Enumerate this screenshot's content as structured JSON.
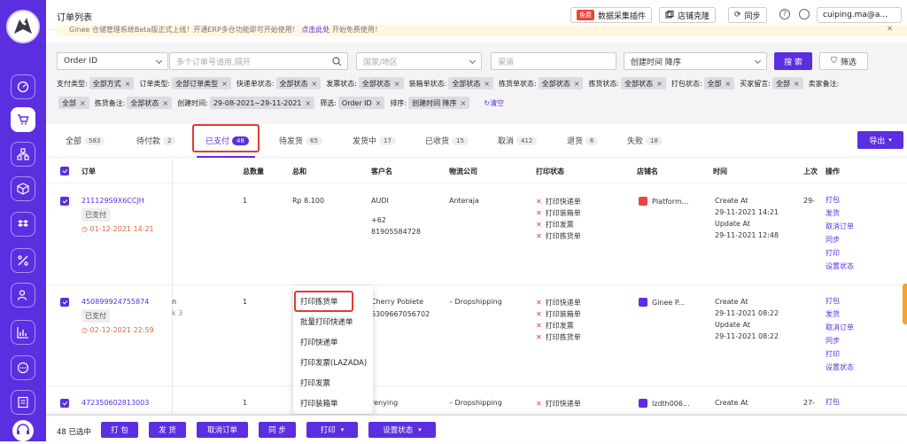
{
  "app": {
    "title": "订单列表"
  },
  "topbar": {
    "free_badge": "免费",
    "plugin_btn": "数据采集插件",
    "clone_btn": "店铺克隆",
    "sync_btn": "同步",
    "user": "cuiping.ma@a..."
  },
  "notice": {
    "text": "Ginee 仓储管理系统Beta版正式上线！开通ERP多仓功能即可开始使用！",
    "link": "点击此处",
    "tail": "开始免费使用！"
  },
  "filters": {
    "order_select": "Order ID",
    "search_placeholder": "多个订单号请用,隔开",
    "country_placeholder": "国家/地区",
    "channel_placeholder": "渠道",
    "sort_select": "创建时间 降序",
    "search_btn": "搜 索",
    "filter_btn": "筛选",
    "line1": [
      {
        "label": "支付类型:",
        "chip": "全部方式"
      },
      {
        "label": "订单类型:",
        "chip": "全部订单类型"
      },
      {
        "label": "快递单状态:",
        "chip": "全部状态"
      },
      {
        "label": "发票状态:",
        "chip": "全部状态"
      },
      {
        "label": "装箱单状态:",
        "chip": "全部状态"
      },
      {
        "label": "拣货单状态:",
        "chip": "全部状态"
      },
      {
        "label": "拣货状态:",
        "chip": "全部状态"
      },
      {
        "label": "打包状态:",
        "chip": "全部"
      },
      {
        "label": "买家留言:",
        "chip": "全部"
      },
      {
        "label": "卖家备注:",
        "chip": ""
      }
    ],
    "line2": [
      {
        "label": "",
        "chip": "全部"
      },
      {
        "label": "拣货备注:",
        "chip": "全部状态"
      },
      {
        "label": "创建时间:",
        "chip": "29-08-2021~29-11-2021"
      },
      {
        "label": "筛选:",
        "chip": "Order ID"
      },
      {
        "label": "排序:",
        "chip": "创建时间 降序"
      }
    ],
    "clear": "清空"
  },
  "tabs": [
    {
      "label": "全部",
      "count": "583"
    },
    {
      "label": "待付款",
      "count": "2"
    },
    {
      "label": "已支付",
      "count": "48"
    },
    {
      "label": "待发货",
      "count": "65"
    },
    {
      "label": "发货中",
      "count": "17"
    },
    {
      "label": "已收货",
      "count": "15"
    },
    {
      "label": "取消",
      "count": "412"
    },
    {
      "label": "退货",
      "count": "6"
    },
    {
      "label": "失败",
      "count": "18"
    }
  ],
  "export_btn": "导出",
  "table": {
    "headers": {
      "order": "订单",
      "qty": "总数量",
      "total": "总和",
      "customer": "客户名",
      "logistics": "物流公司",
      "print_status": "打印状态",
      "shop": "店铺名",
      "time": "时间",
      "last": "上次",
      "actions": "操作"
    },
    "rows": [
      {
        "order_id": "211129S9X6CCJH",
        "status": "已支付",
        "date": "01-12-2021 14:21",
        "hidden": "",
        "hidden2": "",
        "qty": "1",
        "total": "Rp 8.100",
        "customer": "AUDI",
        "phone": "+62",
        "phone2": "81905584728",
        "logistics": "Anteraja",
        "prints": [
          "打印快递单",
          "打印装箱单",
          "打印发票",
          "打印拣货单"
        ],
        "shop": "Platform...",
        "created_label": "Create At",
        "created": "29-11-2021 14:21",
        "updated_label": "Update At",
        "updated": "29-11-2021 12:48",
        "last": "29-",
        "actions": [
          "打包",
          "发货",
          "取消订单",
          "同步",
          "打印",
          "设置状态"
        ]
      },
      {
        "order_id": "450899924755874",
        "status": "已支付",
        "date": "02-12-2021 22:59",
        "hidden": "n",
        "hidden2": "k 3",
        "qty": "1",
        "total": "",
        "customer": "Cherry Poblete",
        "phone": "6309667056702",
        "phone2": "",
        "logistics": "– Dropshipping",
        "prints": [
          "打印快递单",
          "打印装箱单",
          "打印发票",
          "打印拣货单"
        ],
        "shop": "Ginee P...",
        "created_label": "Create At",
        "created": "29-11-2021 08:22",
        "updated_label": "Update At",
        "updated": "29-11-2021 08:22",
        "last": "",
        "actions": [
          "打包",
          "发货",
          "取消订单",
          "同步",
          "打印",
          "设置状态"
        ]
      },
      {
        "order_id": "472350602813003",
        "status": "",
        "date": "",
        "hidden": "",
        "hidden2": "",
        "qty": "1",
        "total": "",
        "customer": "renying",
        "phone": "",
        "phone2": "",
        "logistics": "– Dropshipping",
        "prints": [
          "打印快递单"
        ],
        "shop": "lzdth006...",
        "created_label": "Create At",
        "created": "",
        "updated_label": "",
        "updated": "",
        "last": "27-",
        "actions": [
          "打包"
        ]
      }
    ]
  },
  "print_menu": [
    "打印拣货单",
    "批量打印快递单",
    "打印快递单",
    "打印发票(LAZADA)",
    "打印发票",
    "打印装箱单"
  ],
  "bottom": {
    "selected": "48 已选中",
    "pack": "打 包",
    "ship": "发 货",
    "cancel": "取消订单",
    "sync": "同 步",
    "print": "打印",
    "set_status": "设置状态"
  },
  "colors": {
    "brand": "#5b2ee0",
    "highlight": "#e53935"
  }
}
